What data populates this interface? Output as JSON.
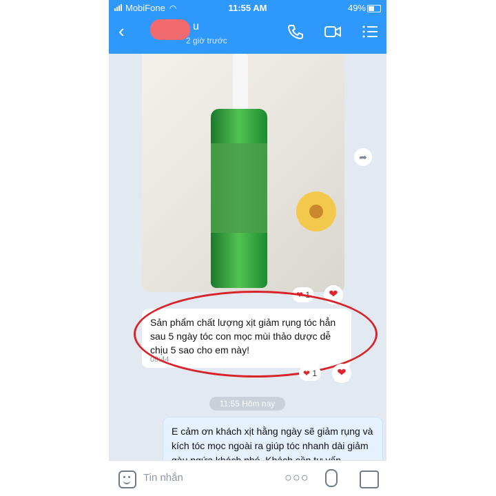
{
  "status_bar": {
    "carrier": "MobiFone",
    "time": "11:55 AM",
    "battery": "49%",
    "battery_level": 0.49
  },
  "header": {
    "contact_name": "u",
    "last_seen": "2 giờ trước",
    "icons": [
      "back-icon",
      "phone-icon",
      "video-icon",
      "menu-icon"
    ]
  },
  "messages": {
    "image_reaction_count": "1",
    "incoming_text": "Sản phẩm chất lượng xịt giảm rụng tóc hẳn sau 5 ngày tóc con mọc mùi thảo dược dễ chịu 5 sao cho em này!",
    "incoming_time": "09:44",
    "incoming_reaction_count": "1",
    "date_divider": "11:55 Hôm nay",
    "outgoing_text": "E cảm ơn khách xịt hằng ngày sẽ giảm rụng và kích tóc mọc ngoài ra giúp tóc nhanh dài giảm gàu ngứa khách nhé. Khách cần tư vấn"
  },
  "input": {
    "placeholder": "Tin nhắn",
    "icons": [
      "emoji-icon",
      "more-icon",
      "mic-icon",
      "image-icon"
    ]
  },
  "colors": {
    "header": "#2f98fb",
    "chat_bg": "#e2e9f1",
    "outgoing_bubble": "#e5f1ff",
    "highlight": "#d8232a",
    "heart": "#e0242d"
  }
}
